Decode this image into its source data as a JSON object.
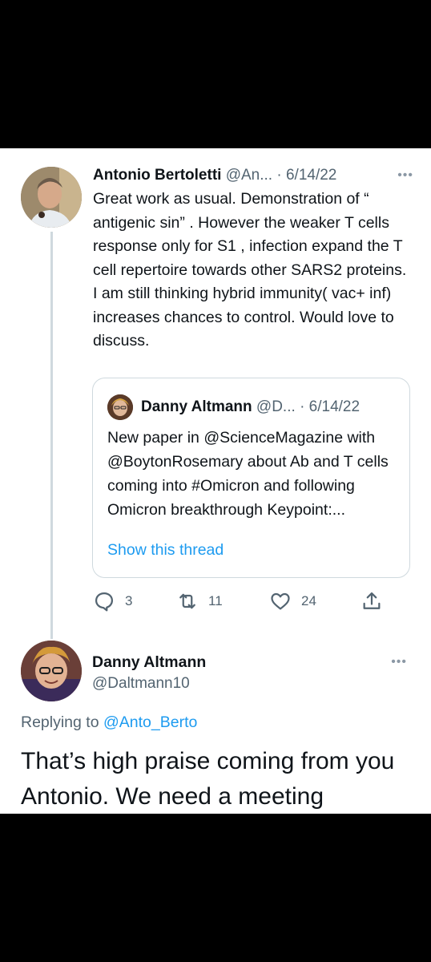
{
  "tweet1": {
    "author_name": "Antonio Bertoletti",
    "handle": "@An...",
    "separator": "·",
    "date": "6/14/22",
    "more_icon": "more-dots-icon",
    "body": "Great work as usual. Demonstration of “ antigenic sin” . However the weaker T cells response only for S1 , infection expand the T cell repertoire towards other SARS2 proteins. I am still thinking hybrid immunity( vac+ inf) increases chances to control. Would love to discuss."
  },
  "quoted": {
    "author_name": "Danny Altmann",
    "handle": "@D...",
    "separator": "·",
    "date": "6/14/22",
    "body": "New paper in @ScienceMagazine with @BoytonRosemary about Ab and T cells coming into #Omicron and following Omicron breakthrough Keypoint:...",
    "link_label": "Show this thread"
  },
  "actions": {
    "reply_count": "3",
    "retweet_count": "11",
    "like_count": "24",
    "icons": [
      "reply-icon",
      "retweet-icon",
      "like-icon",
      "share-icon"
    ]
  },
  "tweet2": {
    "author_name": "Danny Altmann",
    "handle": "@Daltmann10",
    "replying_prefix": "Replying to",
    "replying_handle": "@Anto_Berto",
    "body": "That’s high praise coming from you Antonio. We need a meeting"
  },
  "colors": {
    "accent": "#1d9bf0",
    "muted": "#536471",
    "text": "#0f1419",
    "border": "#cfd9de",
    "background": "#000000"
  }
}
